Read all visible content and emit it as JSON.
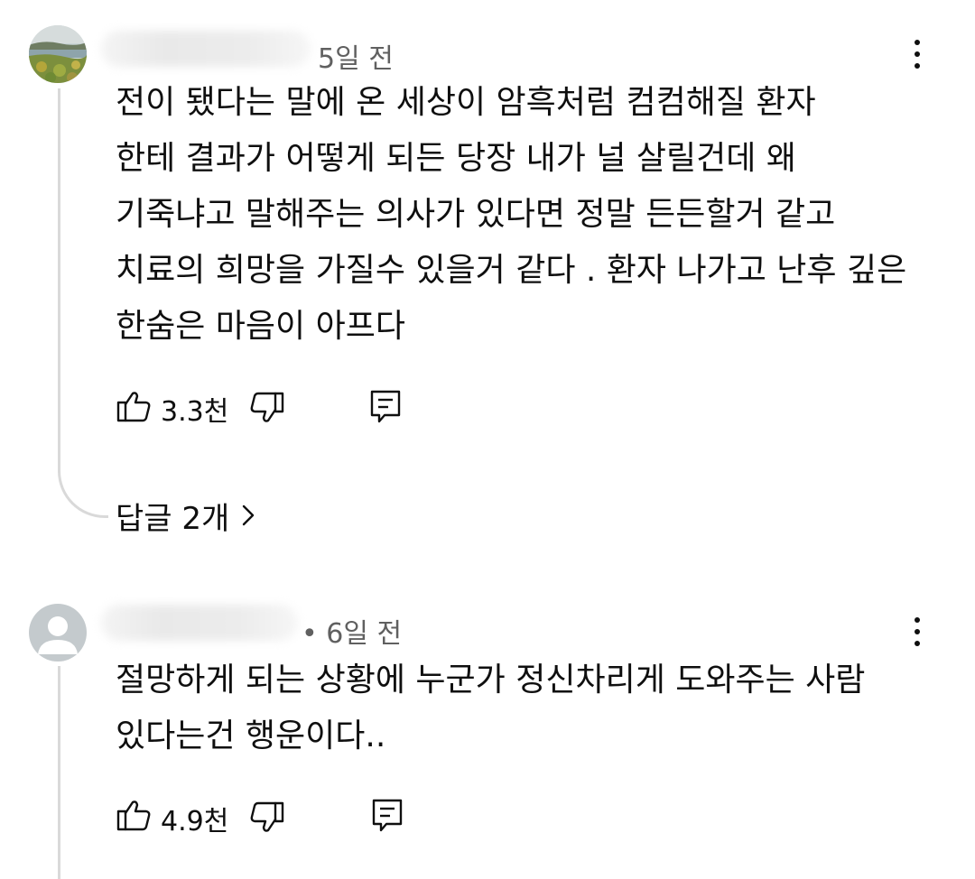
{
  "comments": [
    {
      "age": "5일 전",
      "text": "전이 됐다는 말에 온 세상이 암흑처럼 컴컴해질 환자\n한테 결과가 어떻게 되든 당장 내가 널 살릴건데 왜\n기죽냐고 말해주는 의사가 있다면  정말 든든할거 같고\n치료의 희망을 가질수 있을거 같다 . 환자 나가고 난후 깊은\n한숨은 마음이 아프다",
      "like_count": "3.3천",
      "replies_label": "답글 2개"
    },
    {
      "age": "• 6일 전",
      "text": "절망하게 되는 상황에 누군가 정신차리게 도와주는 사람\n있다는건 행운이다..",
      "like_count": "4.9천"
    }
  ],
  "icons": {
    "more": "more-vert-icon",
    "like": "thumb-up-icon",
    "dislike": "thumb-down-icon",
    "reply": "reply-comment-icon",
    "chevron": "chevron-right-icon"
  }
}
